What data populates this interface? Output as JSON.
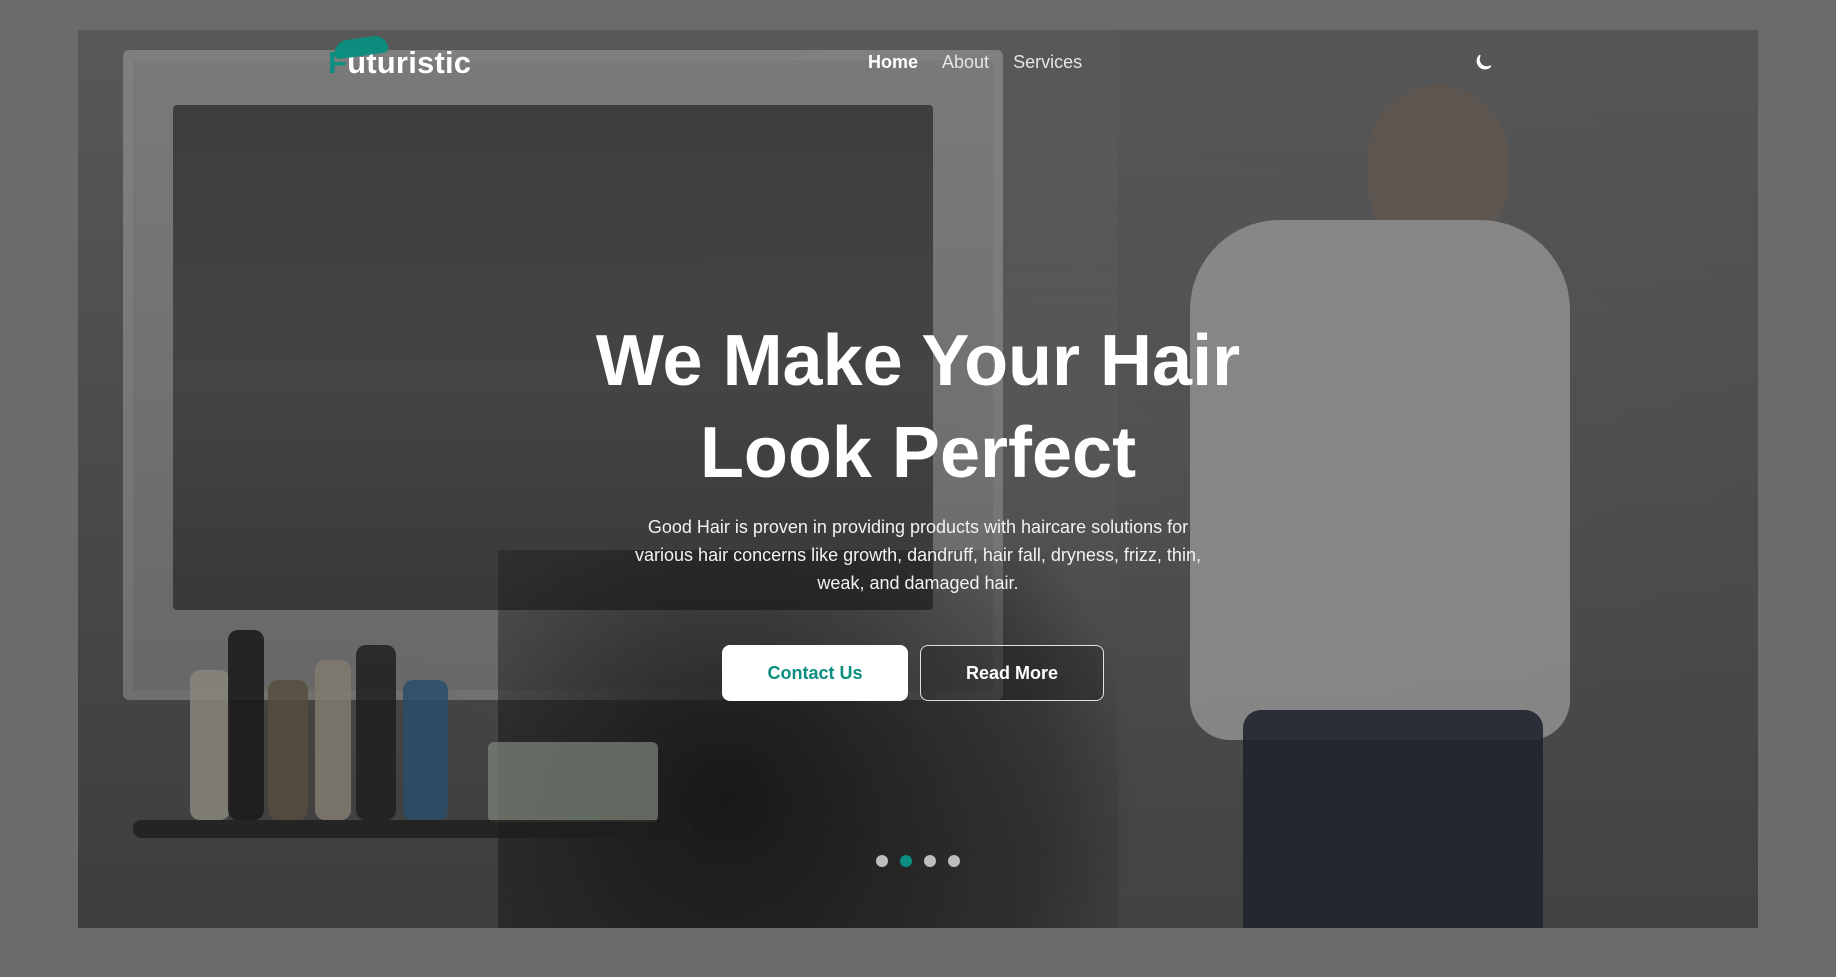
{
  "brand": {
    "first_letter": "F",
    "rest": "uturistic",
    "accent_color": "#0a8f80"
  },
  "nav": {
    "items": [
      {
        "label": "Home",
        "active": true
      },
      {
        "label": "About",
        "active": false
      },
      {
        "label": "Services",
        "active": false
      }
    ],
    "theme_toggle_icon": "moon-icon"
  },
  "hero": {
    "title_line1": "We Make Your Hair",
    "title_line2": "Look Perfect",
    "description": "Good Hair is proven in providing products with haircare solutions for various hair concerns like growth, dandruff, hair fall, dryness, frizz, thin, weak, and damaged hair."
  },
  "buttons": {
    "primary_label": "Contact Us",
    "secondary_label": "Read More"
  },
  "carousel": {
    "slides_count": 4,
    "active_index": 1
  }
}
